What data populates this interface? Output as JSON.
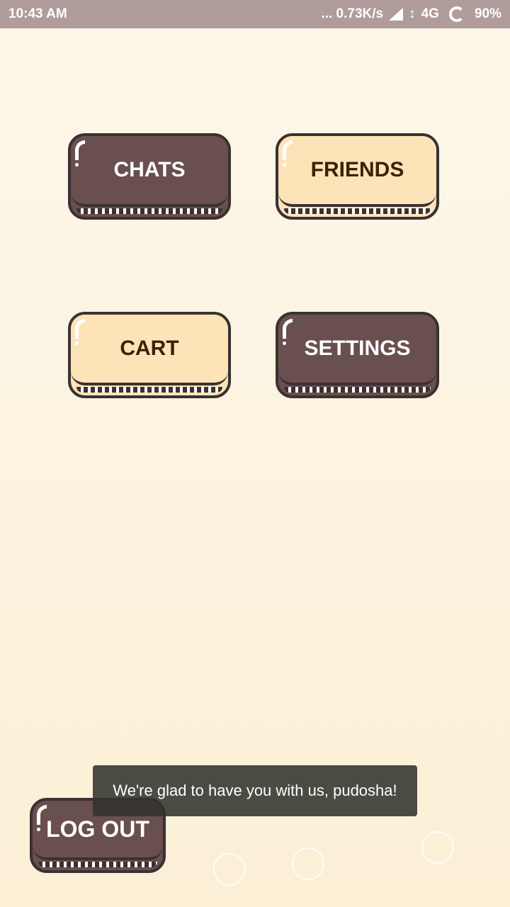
{
  "status_bar": {
    "time": "10:43 AM",
    "network_speed": "... 0.73K/s",
    "network_type": "4G",
    "battery": "90%"
  },
  "menu": {
    "chats_label": "CHATS",
    "friends_label": "FRIENDS",
    "cart_label": "CART",
    "settings_label": "SETTINGS"
  },
  "logout_label": "LOG OUT",
  "toast_message": "We're glad to have you with us, pudosha!",
  "colors": {
    "dark_button": "#6a4f4f",
    "light_button": "#fde4b8",
    "outline": "#3b3131",
    "background_top": "#fdf7ea",
    "background_bottom": "#fbf0d6"
  },
  "icons": [
    "signal-icon",
    "data-transfer-icon",
    "battery-ring-icon"
  ]
}
